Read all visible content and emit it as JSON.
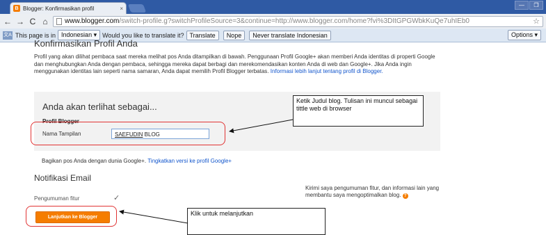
{
  "browser": {
    "tab_title": "Blogger: Konfirmasikan profil",
    "tab_close": "×",
    "favicon_label": "B",
    "url_host": "www.blogger.com",
    "url_path": "/switch-profile.g?switchProfileSource=3&continue=http://www.blogger.com/home?fvi%3DItGPGWbkKuQe7uhIEb0",
    "back_icon": "←",
    "forward_icon": "→",
    "reload_icon": "C",
    "home_icon": "⌂",
    "star_icon": "☆",
    "window_buttons": [
      "—",
      "❐"
    ]
  },
  "translate_bar": {
    "icon_label": "文A",
    "lead_text": "This page is in",
    "language": "Indonesian ▾",
    "question": "Would you like to translate it?",
    "translate_btn": "Translate",
    "nope_btn": "Nope",
    "never_btn": "Never translate Indonesian",
    "options_btn": "Options ▾"
  },
  "page": {
    "heading": "Konfirmasikan Profil Anda",
    "intro_text": "Profil yang akan dilihat pembaca saat mereka melihat pos Anda ditampilkan di bawah. Penggunaan Profil Google+ akan memberi Anda identitas di properti Google dan menghubungkan Anda dengan pembaca, sehingga mereka dapat berbagi dan merekomendasikan konten Anda di web dan Google+. Jika Anda ingin menggunakan identitas lain seperti nama samaran, Anda dapat memilih Profil Blogger terbatas.",
    "intro_link": "Informasi lebih lanjut tentang profil di Blogger.",
    "panel": {
      "heading": "Anda akan terlihat sebagai...",
      "subheading": "Profil Blogger",
      "name_label": "Nama Tampilan",
      "name_value_first": "SAEFUDIN",
      "name_value_rest": " BLOG"
    },
    "share_text": "Bagikan pos Anda dengan dunia Google+.",
    "share_link": "Tingkatkan versi ke profil Google+",
    "email_heading": "Notifikasi Email",
    "feature_label": "Pengumuman fitur",
    "feature_check": "✓",
    "feature_desc": "Kirimi saya pengumuman fitur, dan informasi lain yang membantu saya mengoptimalkan blog.",
    "help_icon": "?",
    "continue_btn": "Lanjutkan ke Blogger"
  },
  "annotations": {
    "callout_1": "Ketik Judul blog. Tulisan ini muncul sebagai tittle web di browser",
    "callout_2": "Klik untuk melanjutkan"
  }
}
